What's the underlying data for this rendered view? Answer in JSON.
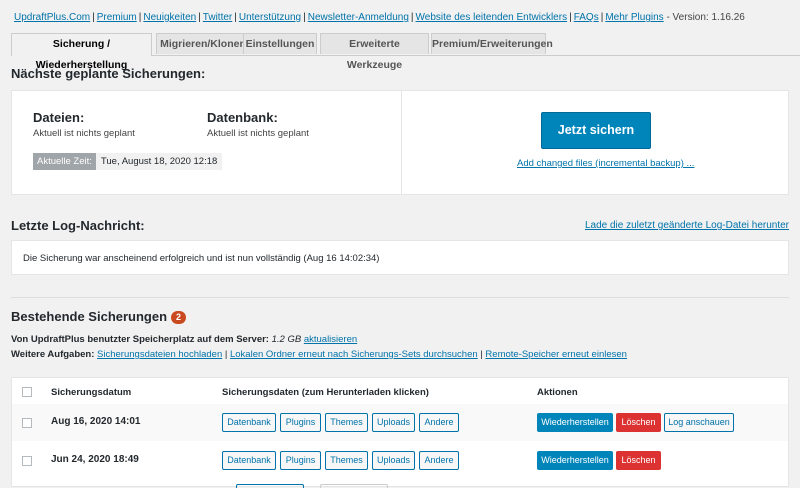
{
  "top_links": [
    "UpdraftPlus.Com",
    "Premium",
    "Neuigkeiten",
    "Twitter",
    "Unterstützung",
    "Newsletter-Anmeldung",
    "Website des leitenden Entwicklers",
    "FAQs",
    "Mehr Plugins"
  ],
  "version_text": "- Version: 1.16.26",
  "tabs": [
    {
      "label": "Sicherung / Wiederherstellung",
      "active": true
    },
    {
      "label": "Migrieren/Klonen",
      "active": false
    },
    {
      "label": "Einstellungen",
      "active": false
    },
    {
      "label": "Erweiterte Werkzeuge",
      "active": false
    },
    {
      "label": "Premium/Erweiterungen",
      "active": false
    }
  ],
  "scheduled": {
    "heading": "Nächste geplante Sicherungen:",
    "files_heading": "Dateien:",
    "files_status": "Aktuell ist nichts geplant",
    "db_heading": "Datenbank:",
    "db_status": "Aktuell ist nichts geplant",
    "time_label": "Aktuelle Zeit:",
    "time_value": "Tue, August 18, 2020 12:18",
    "backup_now": "Jetzt sichern",
    "incremental_link": "Add changed files (incremental backup) ..."
  },
  "log": {
    "heading": "Letzte Log-Nachricht:",
    "load_link": "Lade die zuletzt geänderte Log-Datei herunter",
    "message": "Die Sicherung war anscheinend erfolgreich und ist nun vollständig (Aug 16 14:02:34)"
  },
  "existing": {
    "heading": "Bestehende Sicherungen",
    "count": "2",
    "space_label": "Von UpdraftPlus benutzter Speicherplatz auf dem Server:",
    "space_value": "1.2 GB",
    "space_refresh": "aktualisieren",
    "tasks_label": "Weitere Aufgaben:",
    "task_links": [
      "Sicherungsdateien hochladen",
      "Lokalen Ordner erneut nach Sicherungs-Sets durchsuchen",
      "Remote-Speicher erneut einlesen"
    ]
  },
  "table": {
    "headers": {
      "date": "Sicherungsdatum",
      "data": "Sicherungsdaten (zum Herunterladen klicken)",
      "actions": "Aktionen"
    },
    "rows": [
      {
        "date": "Aug 16, 2020 14:01",
        "downloads": [
          "Datenbank",
          "Plugins",
          "Themes",
          "Uploads",
          "Andere"
        ],
        "restore": "Wiederherstellen",
        "delete": "Löschen",
        "view_log": "Log anschauen"
      },
      {
        "date": "Jun 24, 2020 18:49",
        "downloads": [
          "Datenbank",
          "Plugins",
          "Themes",
          "Uploads",
          "Andere"
        ],
        "restore": "Wiederherstellen",
        "delete": "Löschen"
      }
    ]
  },
  "colors": {
    "primary": "#0085ba",
    "link": "#0073aa",
    "danger": "#dc3232",
    "badge": "#ca4a1f"
  }
}
